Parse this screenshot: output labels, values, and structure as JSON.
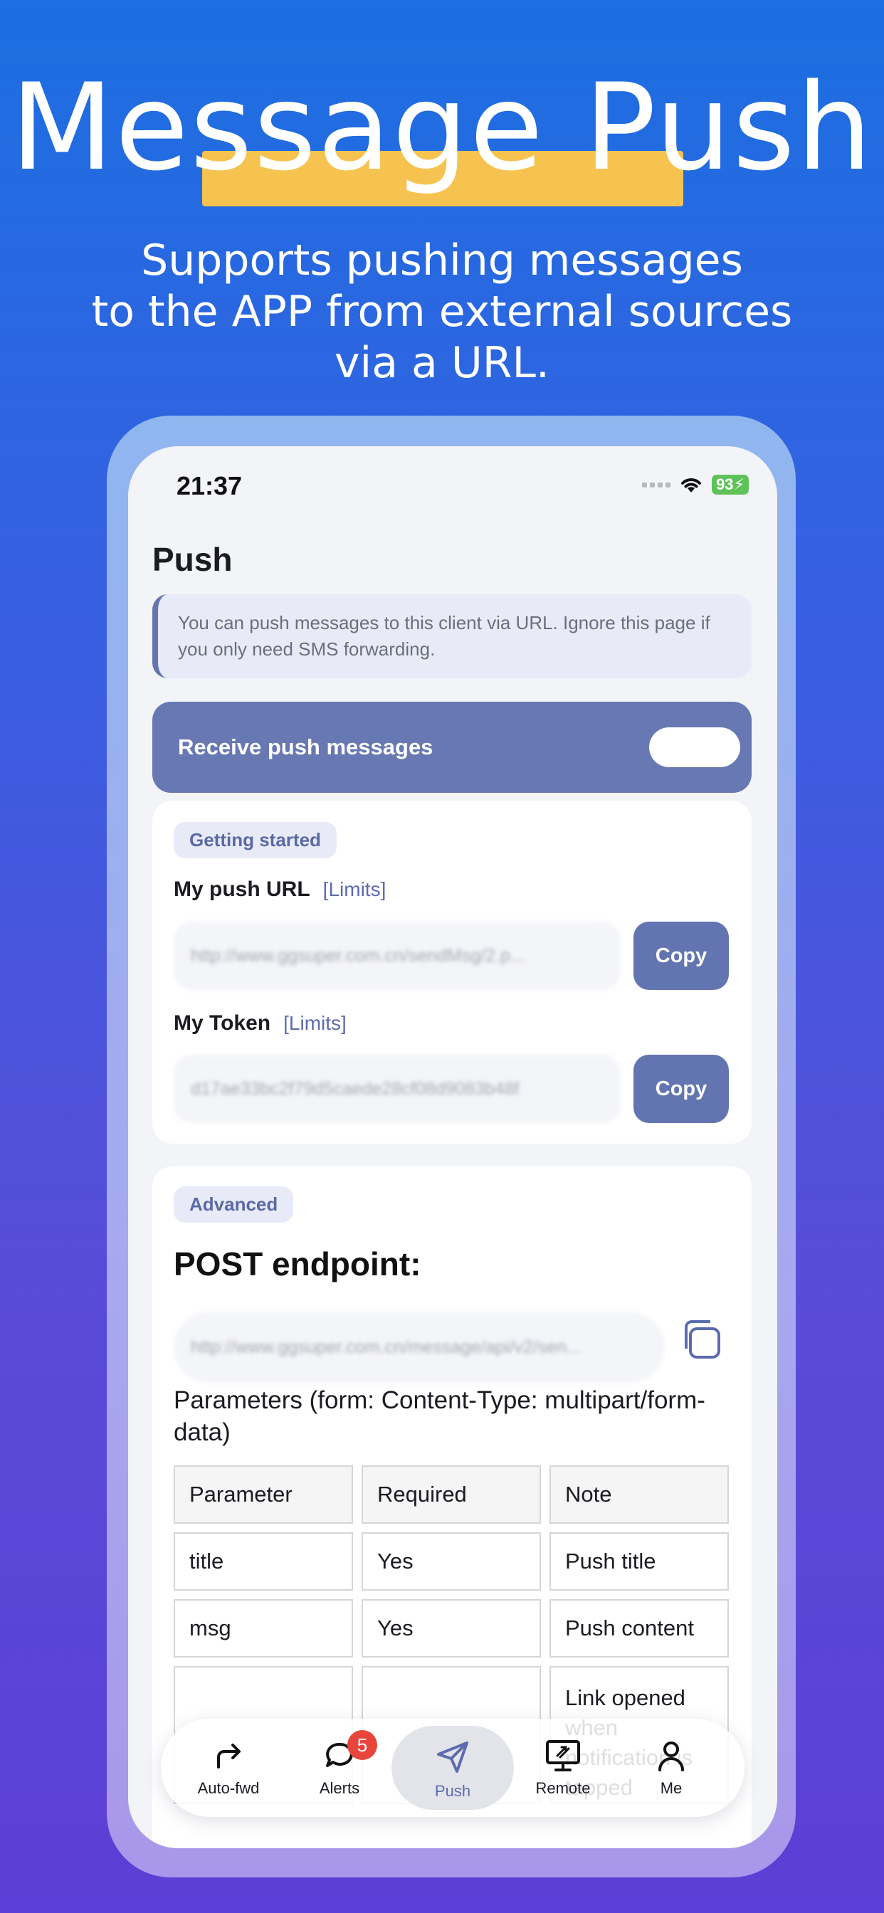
{
  "hero": {
    "title": "Message Push",
    "subtitle_line1": "Supports pushing messages",
    "subtitle_line2": "to the APP from external sources",
    "subtitle_line3": "via a URL."
  },
  "status_bar": {
    "time": "21:37",
    "battery": "93"
  },
  "page": {
    "title": "Push",
    "notice": "You can push messages to this client via URL. Ignore this page if you only need SMS forwarding.",
    "toggle_label": "Receive push messages"
  },
  "getting_started": {
    "tag": "Getting started",
    "push_url_label": "My push URL",
    "push_url_limits": "[Limits]",
    "push_url_value": "http://www.ggsuper.com.cn/sendMsg/2.p...",
    "copy_label": "Copy",
    "token_label": "My Token",
    "token_limits": "[Limits]",
    "token_value": "d17ae33bc2f79d5caede28cf08d9083b48f"
  },
  "advanced": {
    "tag": "Advanced",
    "endpoint_title": "POST endpoint:",
    "endpoint_value": "http://www.ggsuper.com.cn/message/api/v2/sen...",
    "params_text": "Parameters (form: Content-Type: multipart/form-data)",
    "table": {
      "headers": [
        "Parameter",
        "Required",
        "Note"
      ],
      "rows": [
        [
          "title",
          "Yes",
          "Push title"
        ],
        [
          "msg",
          "Yes",
          "Push content"
        ],
        [
          "",
          "",
          "Link opened when notification is tapped"
        ]
      ]
    }
  },
  "tabbar": {
    "items": [
      {
        "label": "Auto-fwd",
        "icon": "forward-arrow-icon"
      },
      {
        "label": "Alerts",
        "icon": "chat-bubble-icon",
        "badge": "5"
      },
      {
        "label": "Push",
        "icon": "send-icon"
      },
      {
        "label": "Remote",
        "icon": "remote-desktop-icon"
      },
      {
        "label": "Me",
        "icon": "person-icon"
      }
    ],
    "active": "Push"
  }
}
